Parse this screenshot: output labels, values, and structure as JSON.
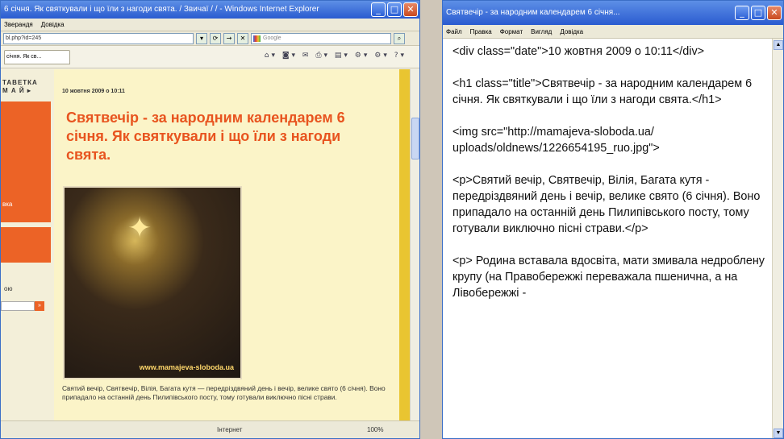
{
  "ie_window": {
    "title": "6 січня. Як святкували і що їли з нагоди свята. / Звичаї / / - Windows Internet Explorer",
    "menu": [
      "Зверандя",
      "Довідка"
    ],
    "address": "bl.php?id=245",
    "search_placeholder": "Google",
    "tab_label": "січня. Як св...",
    "left_logo": "ЛАВЕТКА\nМ А Й",
    "left_item": "вка",
    "left_label": "ою",
    "page": {
      "date": "10 жовтня 2009 о 10:11",
      "title": "Святвечір - за народним календарем 6 січня. Як святкували і що їли з нагоди свята.",
      "watermark": "www.mamajeva-sloboda.ua",
      "caption": "Святий вечір, Святвечір, Вілія, Багата кутя — передріздвяний день і вечір, велике свято (6 січня). Воно припадало на останній день Пилипівського посту, тому готували виключно пісні страви."
    },
    "status": {
      "zone": "Інтернет",
      "zoom": "100%"
    }
  },
  "notepad_window": {
    "title": "Святвечір - за народним календарем 6 січня...",
    "menu": [
      "Файл",
      "Правка",
      "Формат",
      "Вигляд",
      "Довідка"
    ],
    "lines": [
      "<div class=\"date\">10 жовтня 2009 о 10:11</div>",
      "<h1 class=\"title\">Святвечір - за народним календарем 6 січня. Як святкували і що їли з нагоди свята.</h1>",
      "<img src=\"http://mamajeva-sloboda.ua/ uploads/oldnews/1226654195_ruo.jpg\">",
      "<p>Святий вечір, Святвечір, Вілія, Багата кутя - передріздвяний день і вечір, велике свято (6 січня). Воно припадало на останній день Пилипівського посту, тому готували виключно пісні страви.</p>",
      "<p> Родина вставала вдосвіта, мати змивала недроблену крупу (на Правобережжі переважала пшенична, а на Лівобережжі -"
    ]
  }
}
